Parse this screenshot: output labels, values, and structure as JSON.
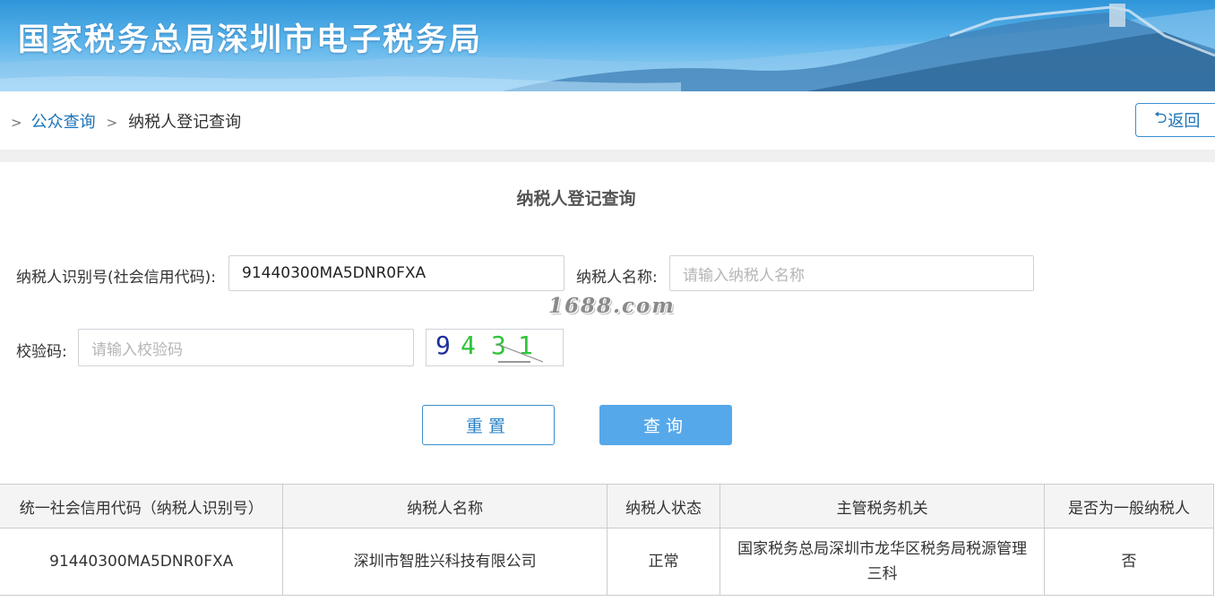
{
  "header": {
    "title": "国家税务总局深圳市电子税务局"
  },
  "breadcrumb": {
    "sep": ">",
    "link": "公众查询",
    "current": "纳税人登记查询"
  },
  "back_button": {
    "icon": "undo-arrow-icon",
    "label": "返回"
  },
  "form": {
    "title": "纳税人登记查询",
    "taxpayer_id_label": "纳税人识别号(社会信用代码):",
    "taxpayer_id_value": "91440300MA5DNR0FXA",
    "taxpayer_name_label": "纳税人名称:",
    "taxpayer_name_placeholder": "请输入纳税人名称",
    "verify_label": "校验码:",
    "verify_placeholder": "请输入校验码",
    "captcha": {
      "d1": "9",
      "d2": "4",
      "d3": "3",
      "d4": "1"
    },
    "reset_label": "重置",
    "query_label": "查询"
  },
  "watermark": "1688.com",
  "results": {
    "headers": [
      "统一社会信用代码（纳税人识别号）",
      "纳税人名称",
      "纳税人状态",
      "主管税务机关",
      "是否为一般纳税人"
    ],
    "rows": [
      [
        "91440300MA5DNR0FXA",
        "深圳市智胜兴科技有限公司",
        "正常",
        "国家税务总局深圳市龙华区税务局税源管理三科",
        "否"
      ]
    ]
  },
  "colors": {
    "accent": "#3a8fd0",
    "query_button": "#55a8ea",
    "link": "#1a73b8"
  }
}
